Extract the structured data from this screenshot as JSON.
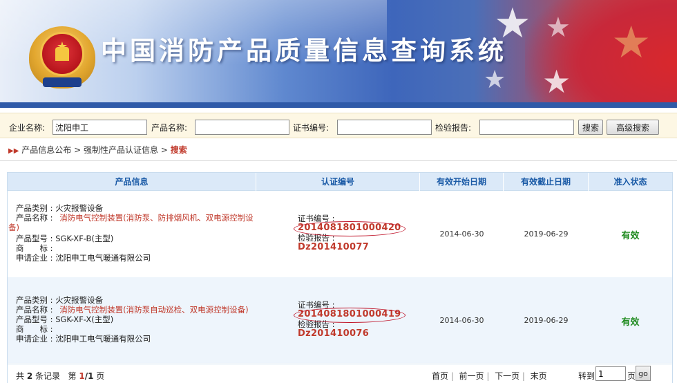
{
  "header": {
    "title": "中国消防产品质量信息查询系统",
    "emblem_icon": "police-emblem",
    "colors": {
      "banner_blue": "#3e66bb",
      "flag_red": "#d23a3a"
    }
  },
  "search": {
    "company_label": "企业名称:",
    "company_value": "沈阳申工",
    "product_label": "产品名称:",
    "product_value": "",
    "cert_label": "证书编号:",
    "cert_value": "",
    "report_label": "检验报告:",
    "report_value": "",
    "search_button": "搜索",
    "advanced_button": "高级搜索"
  },
  "breadcrumb": {
    "item1": "产品信息公布",
    "sep": ">",
    "item2": "强制性产品认证信息",
    "current": "搜索"
  },
  "table": {
    "headers": [
      "产品信息",
      "认证编号",
      "有效开始日期",
      "有效截止日期",
      "准入状态"
    ],
    "rows": [
      {
        "category_label": "产品类别 :",
        "category": "火灾报警设备",
        "name_label": "产品名称 :",
        "name_part1": "消防电气控制装置(消防泵、防排烟风机、双电源控制设",
        "name_part2": "备)",
        "model_label": "产品型号 :",
        "model": "SGK-XF-B(主型)",
        "brand_label": "商　　标 :",
        "brand": "",
        "company_label": "申请企业 :",
        "company": "沈阳申工电气暖通有限公司",
        "cert_label": "证书编号 :",
        "cert_no": "2014081801000420",
        "report_label": "检验报告 :",
        "report_no": "Dz201410077",
        "start_date": "2014-06-30",
        "end_date": "2019-06-29",
        "status": "有效"
      },
      {
        "category_label": "产品类别 :",
        "category": "火灾报警设备",
        "name_label": "产品名称 :",
        "name_part1": "消防电气控制装置(消防泵自动巡检、双电源控制设备)",
        "name_part2": "",
        "model_label": "产品型号 :",
        "model": "SGK-XF-X(主型)",
        "brand_label": "商　　标 :",
        "brand": "",
        "company_label": "申请企业 :",
        "company": "沈阳申工电气暖通有限公司",
        "cert_label": "证书编号 :",
        "cert_no": "2014081801000419",
        "report_label": "检验报告 :",
        "report_no": "Dz201410076",
        "start_date": "2014-06-30",
        "end_date": "2019-06-29",
        "status": "有效"
      }
    ]
  },
  "pagination": {
    "total_prefix": "共",
    "total_count": "2",
    "total_suffix": "条记录",
    "page_prefix": "第",
    "page_current": "1",
    "page_sep": "/",
    "page_total": "1",
    "page_suffix": "页",
    "first": "首页",
    "prev": "前一页",
    "next": "下一页",
    "last": "末页",
    "goto_label": "转到",
    "goto_value": "1",
    "goto_unit": "页",
    "go_button": "go"
  }
}
